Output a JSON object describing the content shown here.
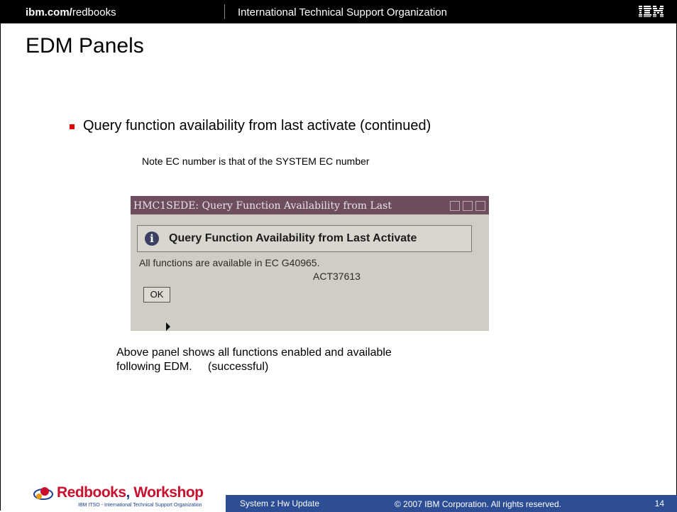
{
  "header": {
    "site_bold": "ibm.com/",
    "site_rest": "redbooks",
    "org": "International Technical Support Organization",
    "logo": "IBM"
  },
  "slide": {
    "title": "EDM Panels",
    "bullet": "Query function availability from last activate (continued)",
    "note": "Note EC number is that of the SYSTEM EC number",
    "caption_line1": "Above panel shows all functions enabled and available",
    "caption_line2": "following EDM.     (successful)"
  },
  "screenshot": {
    "window_title": "HMC1SEDE: Query Function Availability from Last",
    "banner_icon": "info-icon",
    "banner_text": "Query Function Availability from Last Activate",
    "message_line1": "All functions are available in EC G40965.",
    "message_line2": "ACT37613",
    "ok_label": "OK"
  },
  "footer": {
    "logo_word1": "Redbooks",
    "logo_word2": "Workshop",
    "logo_sub": "IBM ITSO - International Technical Support Organization",
    "title": "System z Hw Update",
    "copyright": "© 2007 IBM Corporation. All rights reserved.",
    "page": "14"
  },
  "colors": {
    "bullet": "#e00000",
    "footer_bar": "#2d4e95",
    "window_titlebar": "#6e4d5e"
  }
}
